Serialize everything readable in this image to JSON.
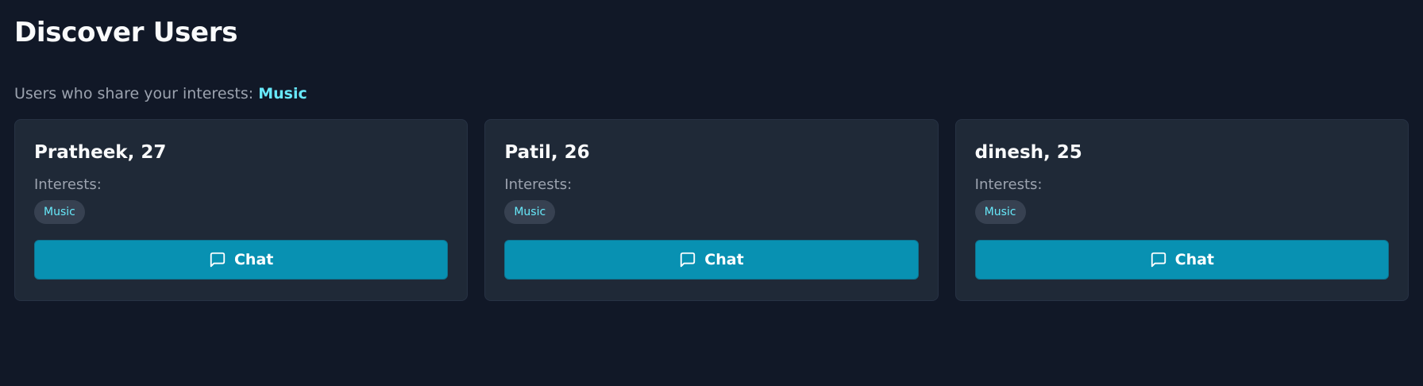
{
  "header": {
    "title": "Discover Users",
    "subtitle_prefix": "Users who share your interests:",
    "subtitle_interest": "Music"
  },
  "users": [
    {
      "name_age": "Pratheek, 27",
      "interests_label": "Interests:",
      "interests": [
        "Music"
      ],
      "chat_label": "Chat"
    },
    {
      "name_age": "Patil, 26",
      "interests_label": "Interests:",
      "interests": [
        "Music"
      ],
      "chat_label": "Chat"
    },
    {
      "name_age": "dinesh, 25",
      "interests_label": "Interests:",
      "interests": [
        "Music"
      ],
      "chat_label": "Chat"
    }
  ],
  "icons": {
    "chat": "chat-bubble-icon"
  },
  "colors": {
    "background": "#111827",
    "card": "#1f2937",
    "accent": "#0891b2",
    "highlight": "#67e8f9",
    "muted_text": "#9ca3af",
    "tag_bg": "#374151"
  }
}
